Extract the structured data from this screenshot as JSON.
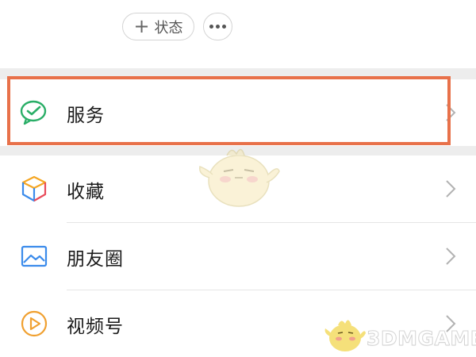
{
  "top": {
    "status_label": "状态",
    "more_icon": "more-horizontal-icon"
  },
  "menu": [
    {
      "label": "服务",
      "icon": "wechat-pay-icon",
      "highlighted": true
    },
    {
      "label": "收藏",
      "icon": "favorites-cube-icon"
    },
    {
      "label": "朋友圈",
      "icon": "moments-image-icon"
    },
    {
      "label": "视频号",
      "icon": "channels-play-icon"
    }
  ],
  "colors": {
    "highlight": "#e8714a",
    "wechat_green": "#2aae67",
    "separator": "#ededed"
  },
  "watermark": {
    "text": "3DMGAME"
  }
}
